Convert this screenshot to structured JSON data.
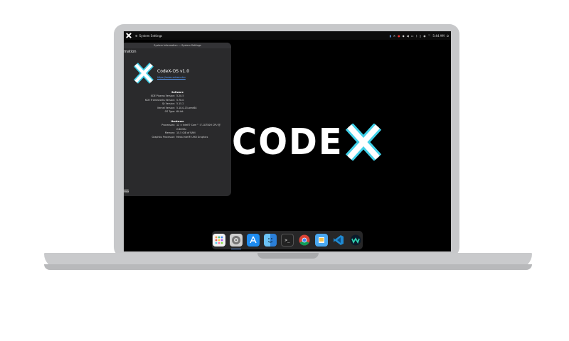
{
  "colors": {
    "accent": "#3fd0e8",
    "link": "#5aa0ff",
    "screen": "#000000",
    "window_bg": "#2a2a2c"
  },
  "topbar": {
    "app_icon": "settings-gear-icon",
    "app_title": "System Settings",
    "clock": "5:44 AM",
    "tray_icons": [
      "user-icon",
      "codex-icon",
      "record-icon",
      "shield-icon",
      "speaker-icon",
      "battery-icon",
      "bluetooth-icon",
      "clipboard-icon",
      "kb-indicator",
      "wifi-icon",
      "power-icon"
    ]
  },
  "window": {
    "breadcrumb": "System Information — System Settings",
    "header_fragment": "mation",
    "os_name": "CodeX-OS v1.0",
    "os_link": "https://www.codexos.dev",
    "software": {
      "heading": "Software",
      "rows": [
        {
          "k": "KDE Plasma Version:",
          "v": "5.20.5"
        },
        {
          "k": "KDE Frameworks Version:",
          "v": "5.78.0"
        },
        {
          "k": "Qt Version:",
          "v": "5.15.2"
        },
        {
          "k": "Kernel Version:",
          "v": "5.10.0-15-amd64"
        },
        {
          "k": "OS Type:",
          "v": "64-bit"
        }
      ]
    },
    "hardware": {
      "heading": "Hardware",
      "rows": [
        {
          "k": "Processors:",
          "v": "12 × Intel® Core™ i7-10750H CPU @ 2.60GHz"
        },
        {
          "k": "Memory:",
          "v": "15.5 GiB of RAM"
        },
        {
          "k": "Graphics Processor:",
          "v": "Mesa Intel® UHD Graphics"
        }
      ]
    },
    "copy_button": "Copy"
  },
  "brand": {
    "text": "CODE"
  },
  "dock": {
    "items": [
      {
        "name": "launcher-icon",
        "active": false
      },
      {
        "name": "system-settings-icon",
        "active": true
      },
      {
        "name": "app-store-icon",
        "active": false
      },
      {
        "name": "finder-icon",
        "active": false
      },
      {
        "name": "terminal-icon",
        "active": false
      },
      {
        "name": "chrome-icon",
        "active": false
      },
      {
        "name": "preview-icon",
        "active": false
      },
      {
        "name": "vscode-icon",
        "active": false
      },
      {
        "name": "webex-icon",
        "active": false
      }
    ]
  }
}
